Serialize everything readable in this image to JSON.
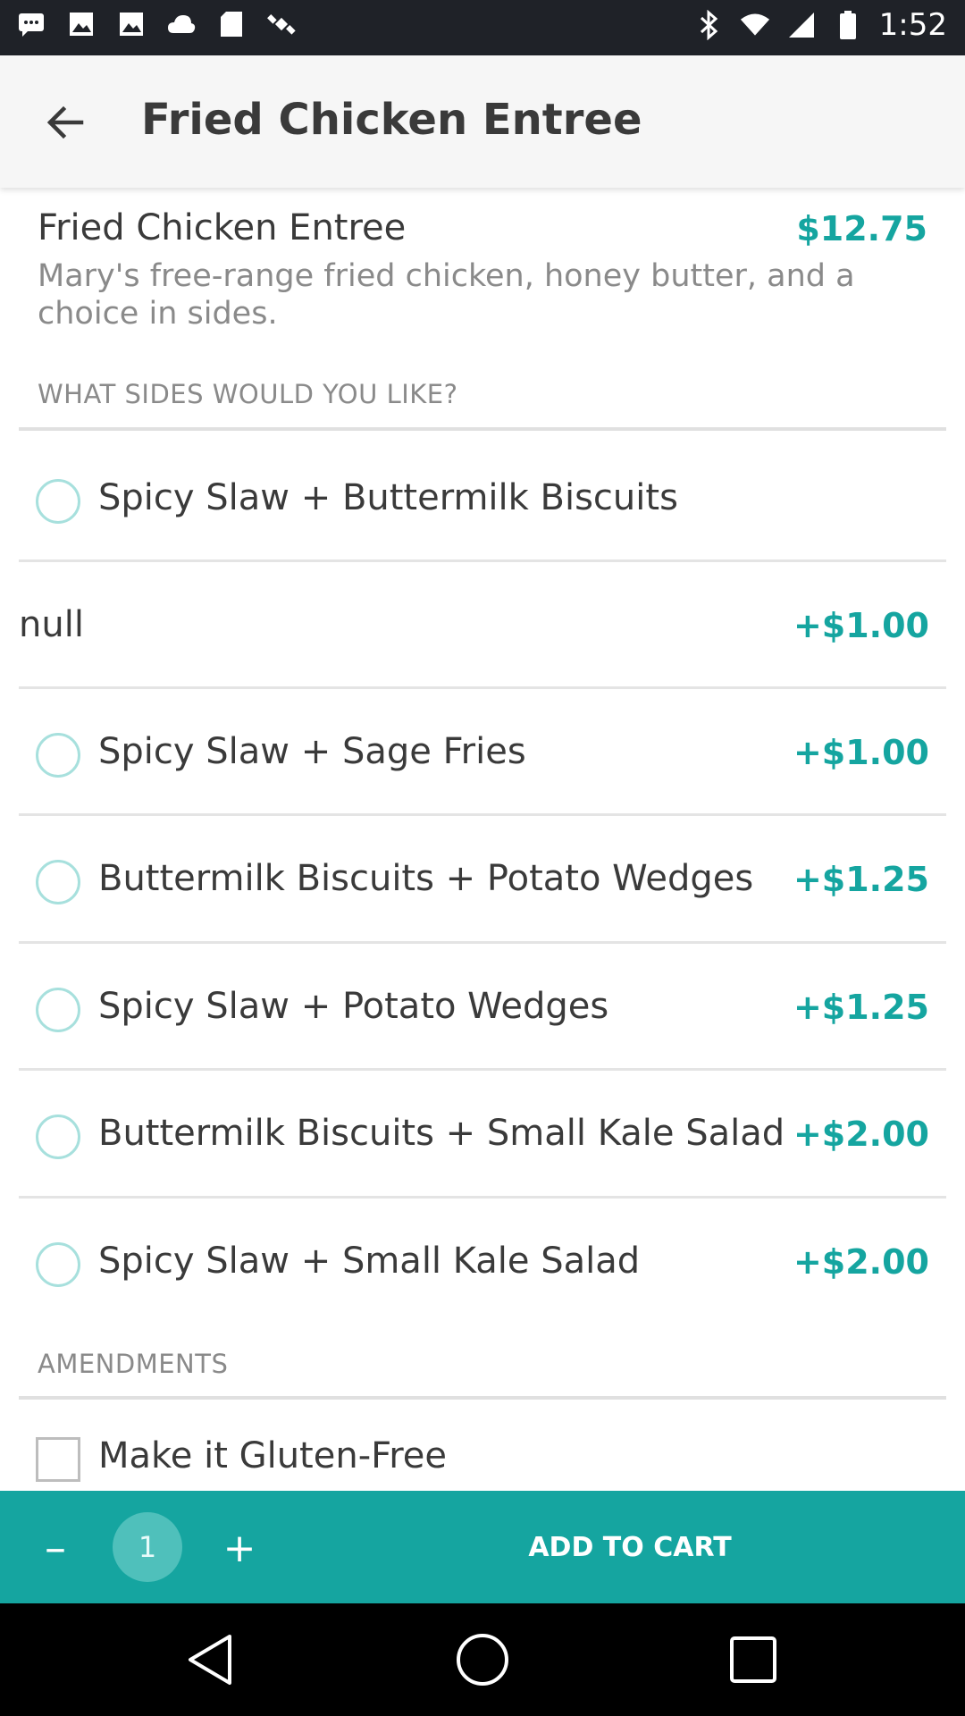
{
  "status_bar": {
    "time": "1:52",
    "left_icons": [
      "message-icon",
      "image-icon",
      "image-icon",
      "cloud-icon",
      "sd-card-icon",
      "satellite-icon"
    ],
    "right_icons": [
      "bluetooth-icon",
      "wifi-icon",
      "signal-icon",
      "battery-icon"
    ]
  },
  "app_bar": {
    "title": "Fried Chicken Entree",
    "back_icon": "back-arrow-icon"
  },
  "item": {
    "name": "Fried Chicken Entree",
    "price": "$12.75",
    "description": "Mary's free-range fried chicken, honey butter, and a choice in sides."
  },
  "sides": {
    "header": "WHAT SIDES WOULD YOU LIKE?",
    "options": [
      {
        "label": "Spicy Slaw + Buttermilk Biscuits",
        "price": ""
      },
      {
        "label": "null",
        "price": "+$1.00"
      },
      {
        "label": "Spicy Slaw + Sage Fries",
        "price": "+$1.00"
      },
      {
        "label": "Buttermilk Biscuits + Potato Wedges",
        "price": "+$1.25"
      },
      {
        "label": "Spicy Slaw + Potato Wedges",
        "price": "+$1.25"
      },
      {
        "label": "Buttermilk Biscuits + Small Kale Salad",
        "price": "+$2.00"
      },
      {
        "label": "Spicy Slaw + Small Kale Salad",
        "price": "+$2.00"
      }
    ]
  },
  "amendments": {
    "header": "AMENDMENTS",
    "options": [
      {
        "label": "Make it Gluten-Free"
      }
    ]
  },
  "cart": {
    "minus_label": "–",
    "quantity": "1",
    "plus_label": "+",
    "add_label": "ADD TO CART"
  },
  "colors": {
    "accent": "#15a5a0",
    "radio_border": "#a7e0dd",
    "status_bar": "#1f2228",
    "app_bar": "#f6f6f6"
  }
}
